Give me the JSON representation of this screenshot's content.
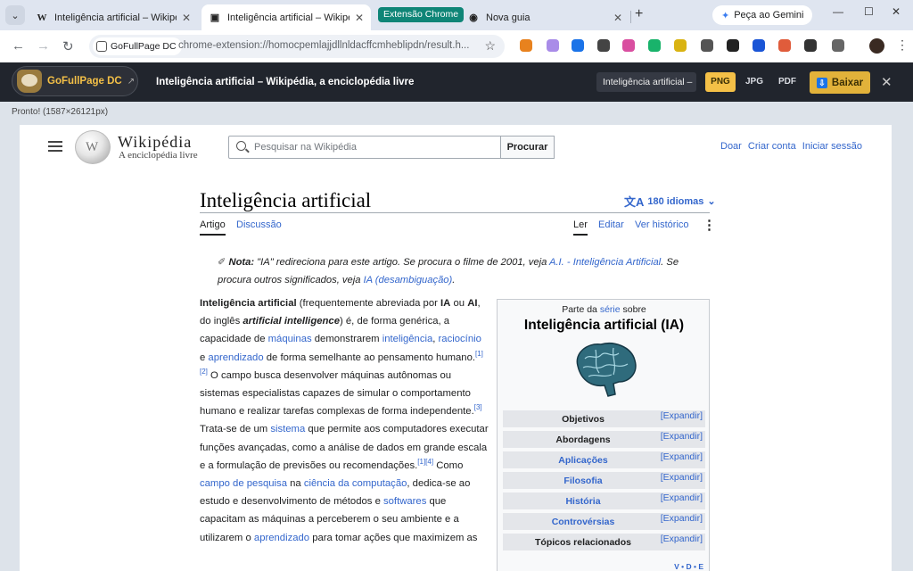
{
  "browser": {
    "tabs": [
      {
        "favicon": "W",
        "title": "Inteligência artificial – Wikipédia",
        "close": "✕"
      },
      {
        "favicon": "▣",
        "title": "Inteligência artificial – Wikipédia",
        "close": "✕"
      },
      {
        "favicon": "◉",
        "title": "Nova guia",
        "close": "✕"
      }
    ],
    "tab_group_label": "Extensão Chrome",
    "gemini_label": "Peça ao Gemini",
    "omnibox_chip": "GoFullPage DC",
    "url": "chrome-extension://homocpemlajjdllnldacffcmheblipdn/result.h...",
    "extension_colors": [
      "#e8821e",
      "#a98ce8",
      "#1a73e8",
      "#444444",
      "#d94fa0",
      "#19b36b",
      "#d9b312",
      "#555555",
      "#222222",
      "#1a55d6",
      "#e05c3b",
      "#333333",
      "#666666"
    ]
  },
  "gofullpage": {
    "app_name": "GoFullPage DC",
    "page_title": "Inteligência artificial – Wikipédia, a enciclopédia livre",
    "filename": "Inteligência artificial –",
    "formats": [
      "PNG",
      "JPG",
      "PDF"
    ],
    "selected_format": "PNG",
    "download_label": "Baixar",
    "status": "Pronto! (1587×26121px)"
  },
  "wiki": {
    "site_name": "Wikipédia",
    "tagline": "A enciclopédia livre",
    "search_placeholder": "Pesquisar na Wikipédia",
    "search_button": "Procurar",
    "top_links": [
      "Doar",
      "Criar conta",
      "Iniciar sessão"
    ],
    "article_title": "Inteligência artificial",
    "languages": "180 idiomas",
    "tabs_left": [
      "Artigo",
      "Discussão"
    ],
    "tabs_right": [
      "Ler",
      "Editar",
      "Ver histórico"
    ],
    "hatnote": {
      "label": "Nota:",
      "t1": " \"IA\" redireciona para este artigo. Se procura o filme de 2001, veja ",
      "l1": "A.I. - Inteligência Artificial",
      "t2": ". Se procura outros significados, veja ",
      "l2": "IA (desambiguação)",
      "t3": "."
    },
    "infobox": {
      "part_prefix": "Parte da ",
      "part_link": "série",
      "part_suffix": " sobre",
      "title": "Inteligência artificial (IA)",
      "expand_label": "[Expandir]",
      "sections": [
        {
          "label": "Objetivos",
          "link": false
        },
        {
          "label": "Abordagens",
          "link": false
        },
        {
          "label": "Aplicações",
          "link": true
        },
        {
          "label": "Filosofia",
          "link": true
        },
        {
          "label": "História",
          "link": true
        },
        {
          "label": "Controvérsias",
          "link": true
        },
        {
          "label": "Tópicos relacionados",
          "link": false
        }
      ],
      "vde": "V • D • E"
    }
  }
}
